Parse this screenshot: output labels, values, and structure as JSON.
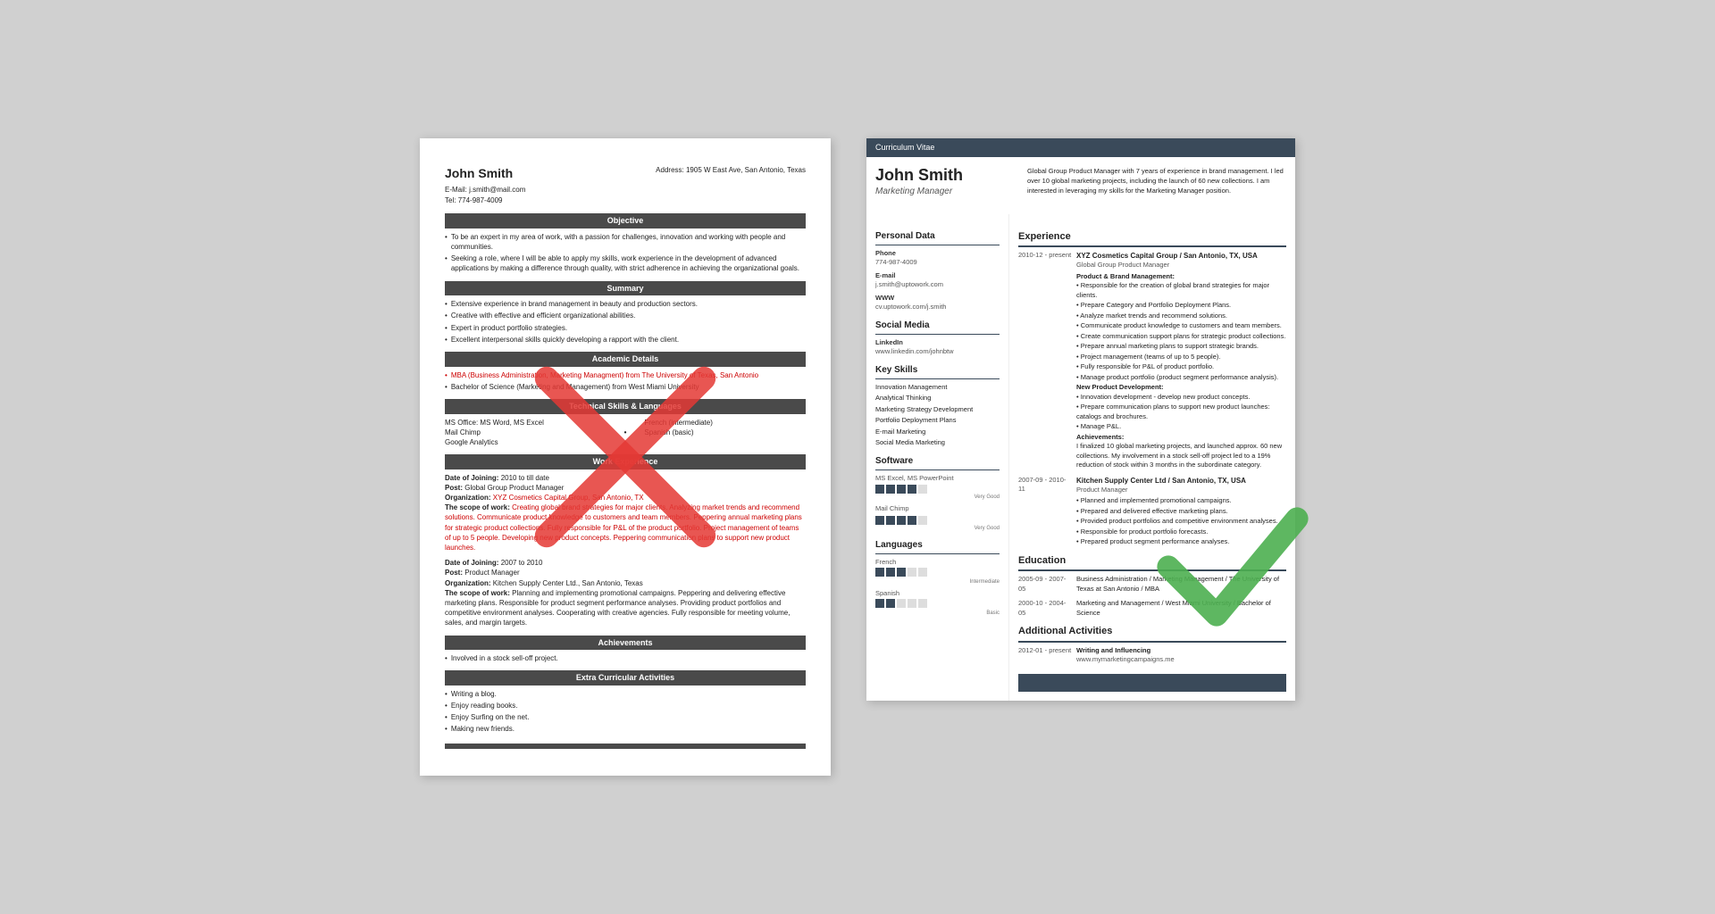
{
  "left_resume": {
    "name": "John Smith",
    "email_label": "E-Mail:",
    "email": "j.smith@mail.com",
    "tel_label": "Tel:",
    "tel": "774-987-4009",
    "address_label": "Address:",
    "address": "1905 W East Ave, San Antonio, Texas",
    "sections": {
      "objective": {
        "title": "Objective",
        "bullets": [
          "To be an expert in my area of work, with a passion for challenges, innovation and working with people and communities.",
          "Seeking a role, where I will be able to apply my skills, work experience in the development of advanced applications by making a difference through quality, with strict adherence in achieving the organizational goals."
        ]
      },
      "summary": {
        "title": "Summary",
        "bullets": [
          "Extensive experience in brand management in beauty and production sectors.",
          "Creative with effective and efficient organizational abilities.",
          "Expert in product portfolio strategies.",
          "Excellent interpersonal skills quickly developing a rapport with the client."
        ]
      },
      "academic": {
        "title": "Academic Details",
        "bullets": [
          "MBA (Business Administration, Marketing Managment) from The University of Texas, San Antonio",
          "Bachelor of Science (Marketing and Management) from West Miami University"
        ]
      },
      "technical": {
        "title": "Technical Skills & Languages",
        "col1": [
          "MS Office: MS Word, MS Excel",
          "Mail Chimp",
          "Google Analytics"
        ],
        "col2": [
          "French (intermediate)",
          "Spanish (basic)"
        ]
      },
      "work": {
        "title": "Work Experience",
        "entries": [
          {
            "date_label": "Date of Joining:",
            "date": "2010 to till date",
            "post_label": "Post:",
            "post": "Global Group Product Manager",
            "org_label": "Organization:",
            "org": "XYZ Cosmetics Capital Group, San Antonio, TX",
            "scope_label": "The scope of work:",
            "scope": "Creating global brand strategies for major clients. Analyzing market trends and recommend solutions. Communicate product knowledge to customers and team members. Peppering annual marketing plans for strategic product collections. Fully responsible for P&L of the product portfolio. Project management of teams of up to 5 people. Developing new product concepts. Peppering communication plans to support new product launches."
          },
          {
            "date_label": "Date of Joining:",
            "date": "2007 to 2010",
            "post_label": "Post:",
            "post": "Product Manager",
            "org_label": "Organization:",
            "org": "Kitchen Supply Center Ltd., San Antonio, Texas",
            "scope_label": "The scope of work:",
            "scope": "Planning and implementing promotional campaigns. Peppering and delivering effective marketing plans. Responsible for product segment performance analyses. Providing product portfolios and competitive environment analyses. Cooperating with creative agencies. Fully responsible for meeting volume, sales, and margin targets."
          }
        ]
      },
      "achievements": {
        "title": "Achievements",
        "bullets": [
          "Involved in a stock sell-off project."
        ]
      },
      "extra": {
        "title": "Extra Curricular Activities",
        "bullets": [
          "Writing a blog.",
          "Enjoy reading books.",
          "Enjoy Surfing on the net.",
          "Making new friends."
        ]
      }
    }
  },
  "right_resume": {
    "cv_banner": "Curriculum Vitae",
    "name": "John Smith",
    "title": "Marketing Manager",
    "intro": "Global Group Product Manager with 7 years of experience in brand management. I led over 10 global marketing projects, including the launch of 60 new collections. I am interested in leveraging my skills for the Marketing Manager position.",
    "personal_data": {
      "section_title": "Personal Data",
      "phone_label": "Phone",
      "phone": "774-987-4009",
      "email_label": "E-mail",
      "email": "j.smith@uptowork.com",
      "www_label": "WWW",
      "www": "cv.uptowork.com/j.smith"
    },
    "social_media": {
      "section_title": "Social Media",
      "linkedin_label": "LinkedIn",
      "linkedin": "www.linkedin.com/johnbtw"
    },
    "key_skills": {
      "section_title": "Key Skills",
      "skills": [
        "Innovation Management",
        "Analytical Thinking",
        "Marketing Strategy Development",
        "Portfolio Deployment Plans",
        "E-mail Marketing",
        "Social Media Marketing"
      ]
    },
    "software": {
      "section_title": "Software",
      "items": [
        {
          "name": "MS Excel, MS PowerPoint",
          "level": "Very Good",
          "filled": 4,
          "total": 5
        },
        {
          "name": "Mail Chimp",
          "level": "Very Good",
          "filled": 4,
          "total": 5
        }
      ]
    },
    "languages": {
      "section_title": "Languages",
      "items": [
        {
          "name": "French",
          "level": "Intermediate",
          "filled": 3,
          "total": 5
        },
        {
          "name": "Spanish",
          "level": "Basic",
          "filled": 2,
          "total": 5
        }
      ]
    },
    "experience": {
      "section_title": "Experience",
      "entries": [
        {
          "dates": "2010-12 - present",
          "company": "XYZ Cosmetics Capital Group / San Antonio, TX, USA",
          "role": "Global Group Product Manager",
          "sections": [
            {
              "label": "Product & Brand Management:",
              "bullets": [
                "Responsible for the creation of global brand strategies for major clients.",
                "Prepare Category and Portfolio Deployment Plans.",
                "Analyze market trends and recommend solutions.",
                "Communicate product knowledge to customers and team members.",
                "Create communication support plans for strategic product collections.",
                "Prepare annual marketing plans to support strategic brands.",
                "Project management (teams of up to 5 people).",
                "Fully responsible for P&L of product portfolio.",
                "Manage product portfolio (product segment performance analysis)."
              ]
            },
            {
              "label": "New Product Development:",
              "bullets": [
                "Innovation development - develop new product concepts.",
                "Prepare communication plans to support new product launches: catalogs and brochures.",
                "Manage P&L."
              ]
            },
            {
              "label": "Achievements:",
              "text": "I finalized 10 global marketing projects, and launched approx. 60 new collections. My involvement in a stock sell-off project led to a 19% reduction of stock within 3 months in the subordinate category."
            }
          ]
        },
        {
          "dates": "2007-09 - 2010-11",
          "company": "Kitchen Supply Center Ltd / San Antonio, TX, USA",
          "role": "Product Manager",
          "bullets": [
            "Planned and implemented promotional campaigns.",
            "Prepared and delivered effective marketing plans.",
            "Provided product portfolios and competitive environment analyses.",
            "Responsible for product portfolio forecasts.",
            "Prepared product segment performance analyses."
          ]
        }
      ]
    },
    "education": {
      "section_title": "Education",
      "entries": [
        {
          "dates": "2005-09 - 2007-05",
          "degree": "Business Administration / Marketing Management / The University of Texas at San Antonio / MBA"
        },
        {
          "dates": "2000-10 - 2004-05",
          "degree": "Marketing and Management / West Miami University / Bachelor of Science"
        }
      ]
    },
    "additional": {
      "section_title": "Additional Activities",
      "entries": [
        {
          "dates": "2012-01 - present",
          "title": "Writing and Influencing",
          "value": "www.mymarketingcampaigns.me"
        }
      ]
    }
  }
}
